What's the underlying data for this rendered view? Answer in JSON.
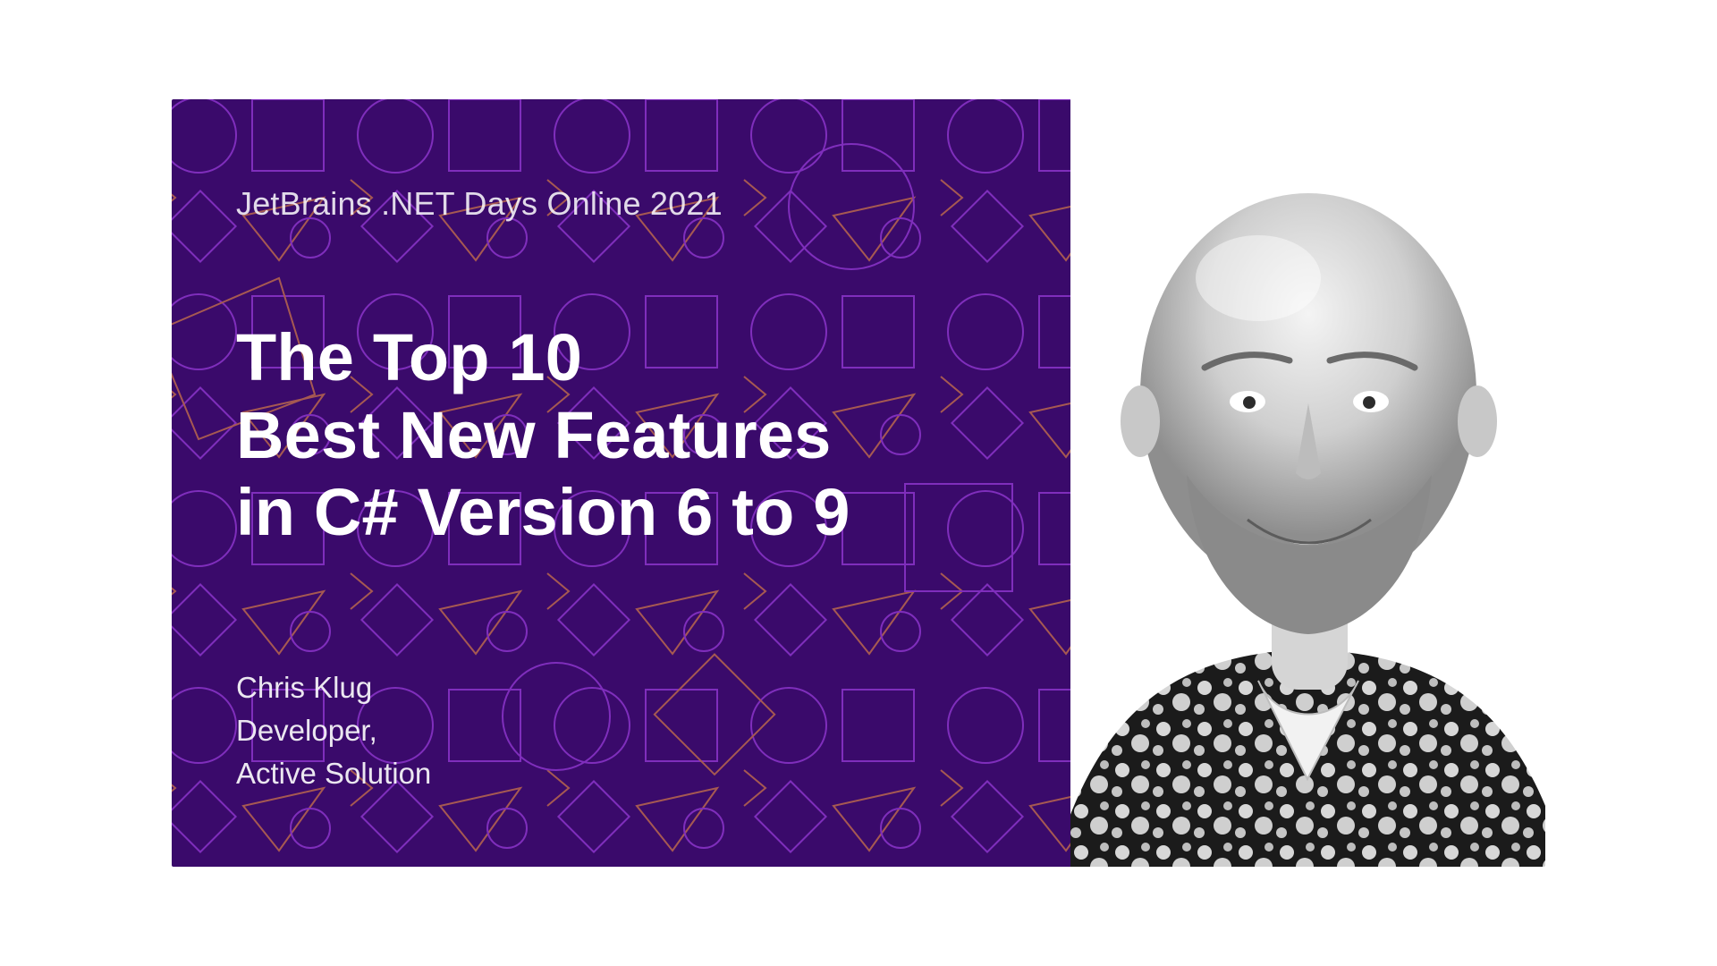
{
  "event": "JetBrains .NET Days Online 2021",
  "title": "The Top 10\nBest New Features\nin C# Version 6 to 9",
  "speaker": {
    "name": "Chris Klug",
    "role": "Developer,",
    "org": "Active Solution"
  },
  "colors": {
    "panel_bg": "#3a0a6b",
    "pattern_stroke_a": "#b84cff",
    "pattern_stroke_b": "#ff9a3d",
    "text": "#ffffff"
  }
}
